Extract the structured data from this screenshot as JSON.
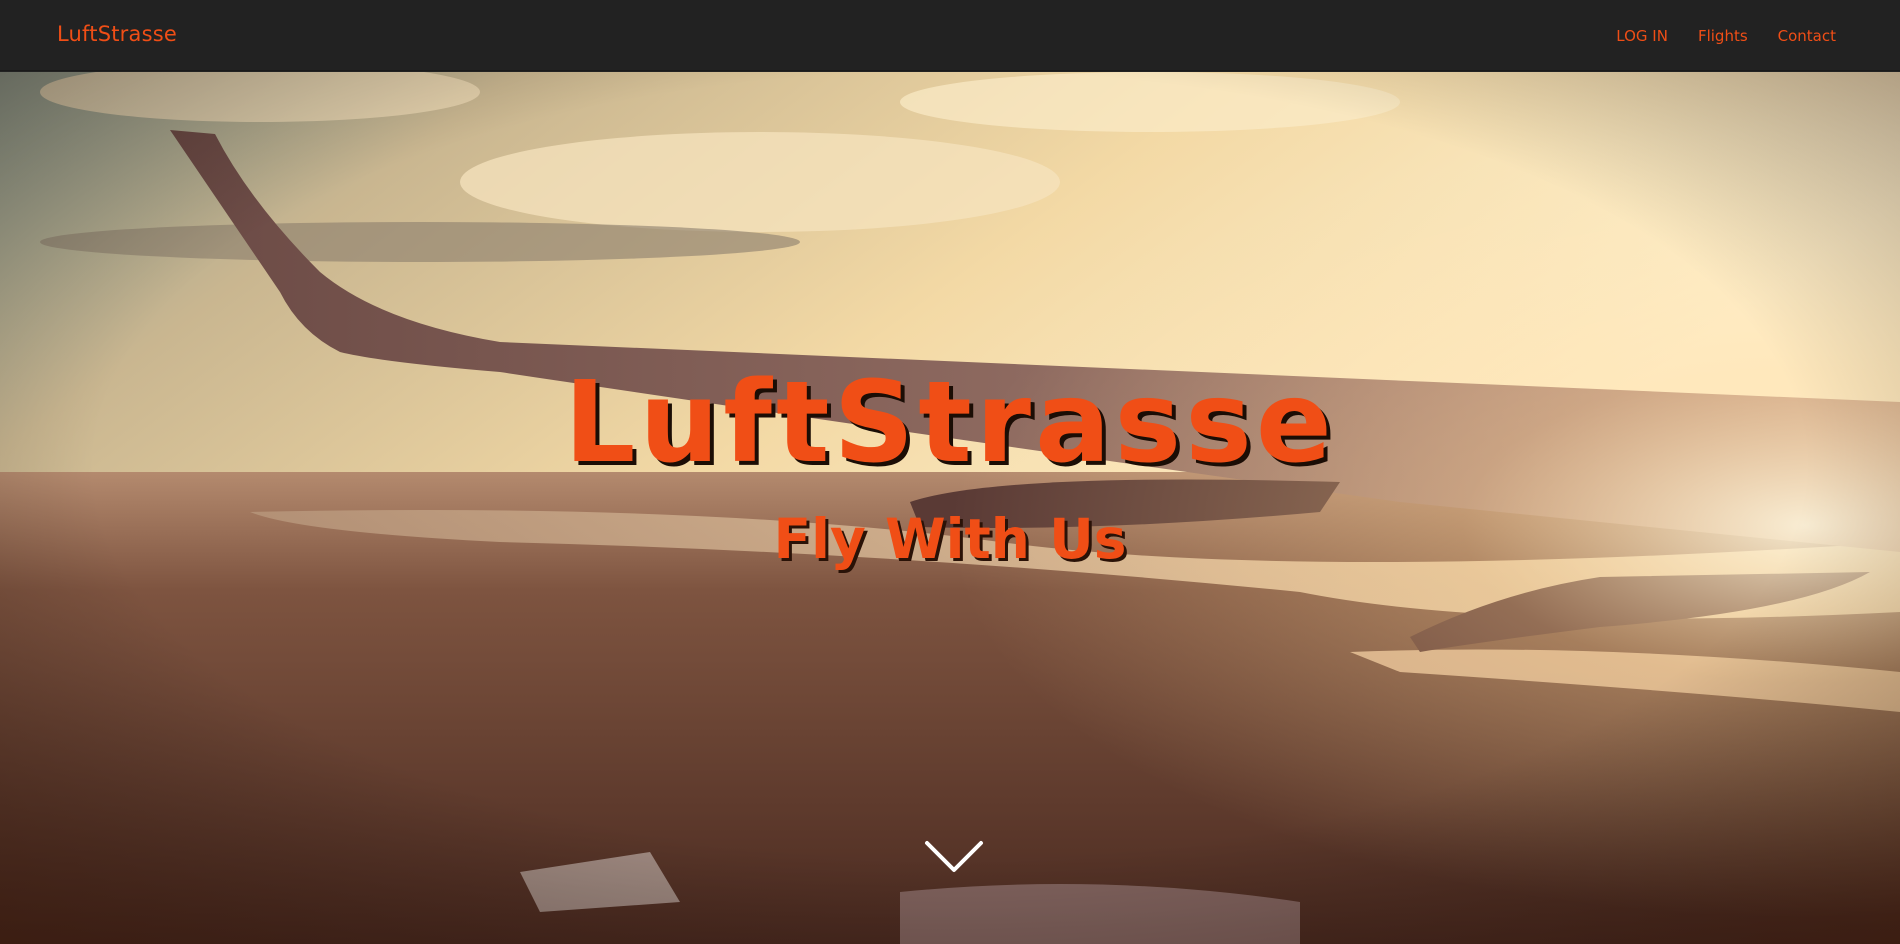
{
  "colors": {
    "accent": "#f04e16",
    "nav_bg": "#222222",
    "chevron": "#ffffff"
  },
  "navbar": {
    "brand": "LuftStrasse",
    "links": [
      {
        "label": "LOG IN"
      },
      {
        "label": "Flights"
      },
      {
        "label": "Contact"
      }
    ]
  },
  "hero": {
    "title": "LuftStrasse",
    "subtitle": "Fly With Us",
    "scroll_icon": "chevron-down-icon"
  }
}
